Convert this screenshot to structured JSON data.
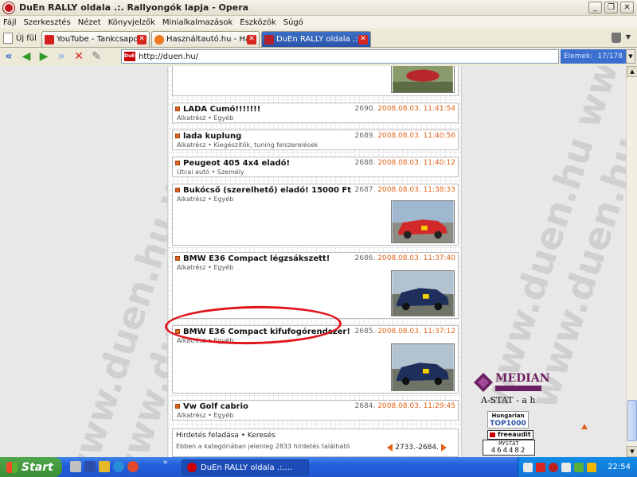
{
  "window": {
    "title": "DuEn RALLY oldala .:. Rallyongók lapja - Opera",
    "buttons": [
      "_",
      "❐",
      "✕"
    ]
  },
  "menu": [
    "Fájl",
    "Szerkesztés",
    "Nézet",
    "Könyvjelzők",
    "Minialkalmazások",
    "Eszközök",
    "Súgó"
  ],
  "tabs": {
    "new_tab_label": "Új fül",
    "items": [
      {
        "label": "YouTube - Tankcsapda - ...",
        "favicon_color": "#d61e1e"
      },
      {
        "label": "Használtautó.hu - Haszn...",
        "favicon_color": "#f07822"
      },
      {
        "label": "DuEn RALLY oldala .:. Ra...",
        "favicon_color": "#b3202a"
      }
    ],
    "close_glyph": "✕"
  },
  "nav": {
    "url": "http://duen.hu/",
    "site_icon_text": "DuEn",
    "element_label": "Elemek:",
    "element_count": "17/178"
  },
  "listings": [
    {
      "title": "LADA Cumó!!!!!!!",
      "num": "2690.",
      "date": "2008.08.03. 11:41:54",
      "category": "Alkatrész • Egyéb"
    },
    {
      "title": "lada kuplung",
      "num": "2689.",
      "date": "2008.08.03. 11:40:56",
      "category": "Alkatrész • Kiegészítők, tuning felszerelések"
    },
    {
      "title": "Peugeot 405 4x4 eladó!",
      "num": "2688.",
      "date": "2008.08.03. 11:40:12",
      "category": "Utcai autó • Személy"
    },
    {
      "title": "Bukócső (szerelhető) eladó! 15000 Ft",
      "num": "2687.",
      "date": "2008.08.03. 11:38:33",
      "category": "Alkatrész • Egyéb"
    },
    {
      "title": "BMW E36 Compact légzsákszett!",
      "num": "2686.",
      "date": "2008.08.03. 11:37:40",
      "category": "Alkatrész • Egyéb"
    },
    {
      "title": "BMW E36 Compact kifufogórendszer!",
      "num": "2685.",
      "date": "2008.08.03. 11:37:12",
      "category": "Alkatrész • Egyéb"
    },
    {
      "title": "Vw Golf cabrio",
      "num": "2684.",
      "date": "2008.08.03. 11:29:45",
      "category": "Alkatrész • Egyéb"
    }
  ],
  "footer": {
    "links": "Hirdetés feladása • Keresés",
    "count_text": "Ebben a kategóriában jelenleg 2833 hirdetés található",
    "pager": "2733.-2684."
  },
  "watermark": "www.duen.hu www.duen.hu",
  "badges": {
    "median": "MEDIAN",
    "astat": "A-STAT - a h",
    "top1000_line1": "Hungarian",
    "top1000_line2": "TOP1000",
    "freeaudit": "freeaudit",
    "mystat_label": "MYSTAT",
    "mystat_value": "464482"
  },
  "taskbar": {
    "start": "Start",
    "task": "DuEn RALLY oldala .:....",
    "clock": "22:54"
  }
}
